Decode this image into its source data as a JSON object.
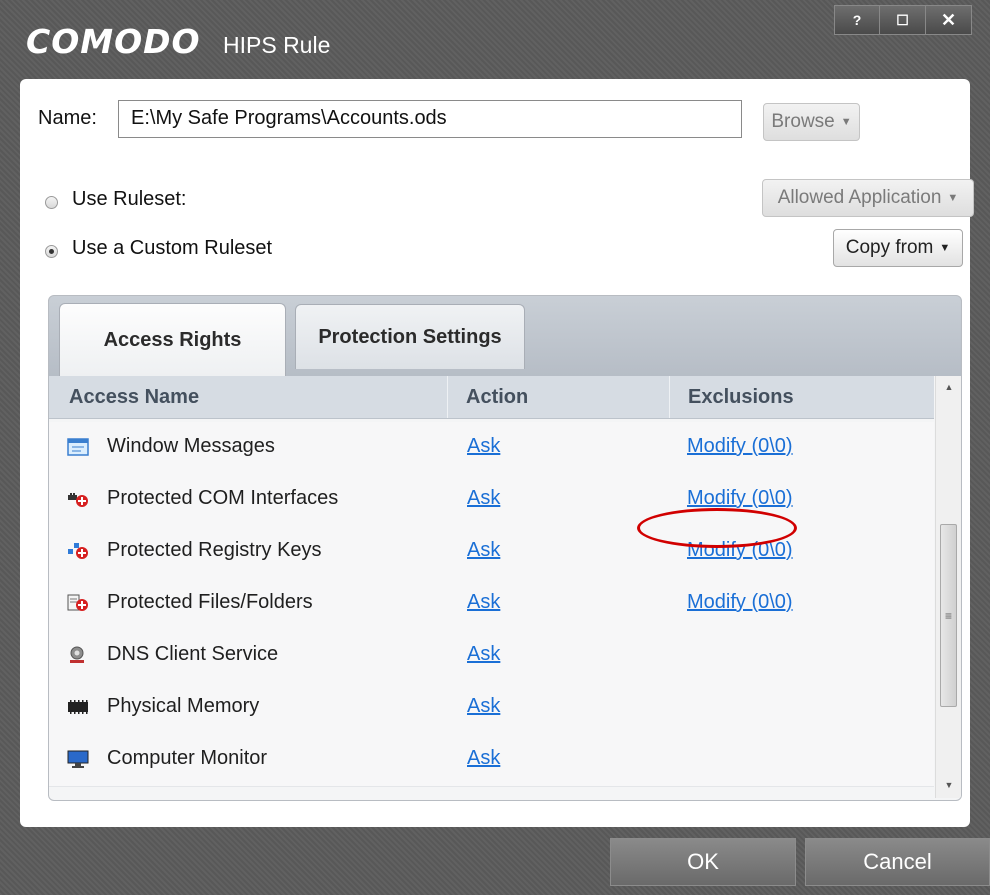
{
  "window": {
    "brand": "COMODO",
    "title": "HIPS Rule",
    "help_glyph": "?",
    "maximize_glyph": "☐",
    "close_glyph": "✕"
  },
  "name": {
    "label": "Name:",
    "value": "E:\\My Safe Programs\\Accounts.ods",
    "browse_label": "Browse"
  },
  "ruleset": {
    "use_ruleset_label": "Use Ruleset:",
    "use_ruleset_checked": false,
    "ruleset_value": "Allowed Application",
    "use_custom_label": "Use a Custom Ruleset",
    "use_custom_checked": true,
    "copy_from_label": "Copy from"
  },
  "tabs": [
    {
      "label": "Access Rights",
      "active": true
    },
    {
      "label": "Protection Settings",
      "active": false
    }
  ],
  "table": {
    "headers": [
      "Access Name",
      "Action",
      "Exclusions"
    ],
    "rows": [
      {
        "name": "Window Messages",
        "icon": "window-messages-icon",
        "action": "Ask",
        "exclusions": "Modify (0\\0)"
      },
      {
        "name": "Protected COM Interfaces",
        "icon": "com-interfaces-icon",
        "action": "Ask",
        "exclusions": "Modify (0\\0)"
      },
      {
        "name": "Protected Registry Keys",
        "icon": "registry-keys-icon",
        "action": "Ask",
        "exclusions": "Modify (0\\0)"
      },
      {
        "name": "Protected Files/Folders",
        "icon": "files-folders-icon",
        "action": "Ask",
        "exclusions": "Modify (0\\0)"
      },
      {
        "name": "DNS Client Service",
        "icon": "dns-client-icon",
        "action": "Ask",
        "exclusions": ""
      },
      {
        "name": "Physical Memory",
        "icon": "physical-memory-icon",
        "action": "Ask",
        "exclusions": ""
      },
      {
        "name": "Computer Monitor",
        "icon": "computer-monitor-icon",
        "action": "Ask",
        "exclusions": ""
      }
    ]
  },
  "scrollbar": {
    "up_glyph": "▲",
    "down_glyph": "▼",
    "grip_glyph": "≡"
  },
  "footer": {
    "ok_label": "OK",
    "cancel_label": "Cancel"
  },
  "colors": {
    "link": "#1a6fd6",
    "highlight": "#d10000",
    "frame": "#5b5b5b"
  }
}
